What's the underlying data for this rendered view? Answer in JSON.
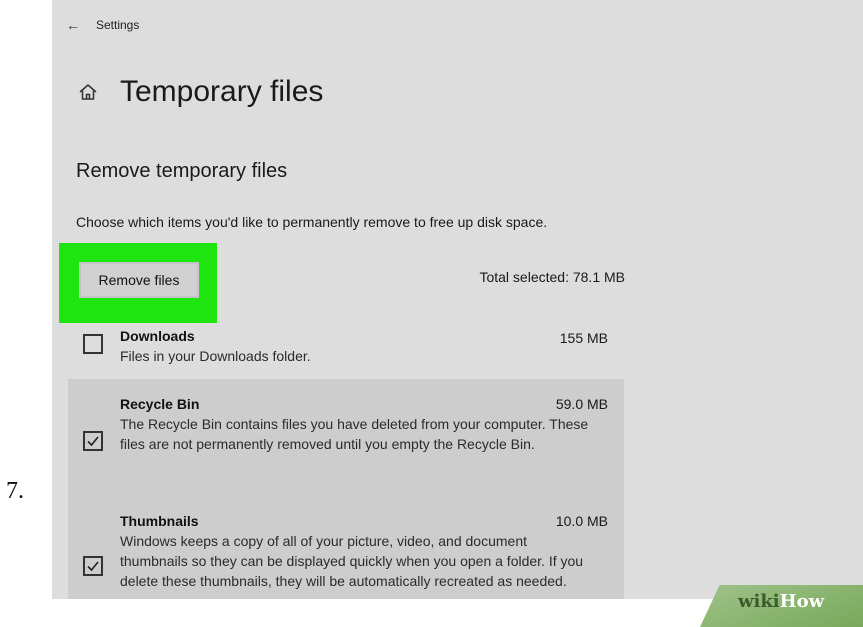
{
  "step": {
    "number": "7."
  },
  "window": {
    "back_label": "←",
    "app_title": "Settings"
  },
  "page": {
    "title": "Temporary files",
    "section_title": "Remove temporary files",
    "description": "Choose which items you'd like to permanently remove to free up disk space.",
    "remove_button_label": "Remove files",
    "total_selected": "Total selected: 78.1 MB"
  },
  "items": [
    {
      "name": "Downloads",
      "size": "155 MB",
      "description": "Files in your Downloads folder.",
      "checked": false
    },
    {
      "name": "Recycle Bin",
      "size": "59.0 MB",
      "description": "The Recycle Bin contains files you have deleted from your computer. These files are not permanently removed until you empty the Recycle Bin.",
      "checked": true
    },
    {
      "name": "Thumbnails",
      "size": "10.0 MB",
      "description": "Windows keeps a copy of all of your picture, video, and document thumbnails so they can be displayed quickly when you open a folder. If you delete these thumbnails, they will be automatically recreated as needed.",
      "checked": true
    }
  ],
  "watermark": {
    "part1": "wiki",
    "part2": "How"
  },
  "colors": {
    "highlight": "#1ee50f",
    "background": "#dddddd",
    "selected_row": "#cdcdcd"
  },
  "icons": {
    "back": "back-arrow-icon",
    "home": "home-icon",
    "check": "checkmark-icon"
  }
}
